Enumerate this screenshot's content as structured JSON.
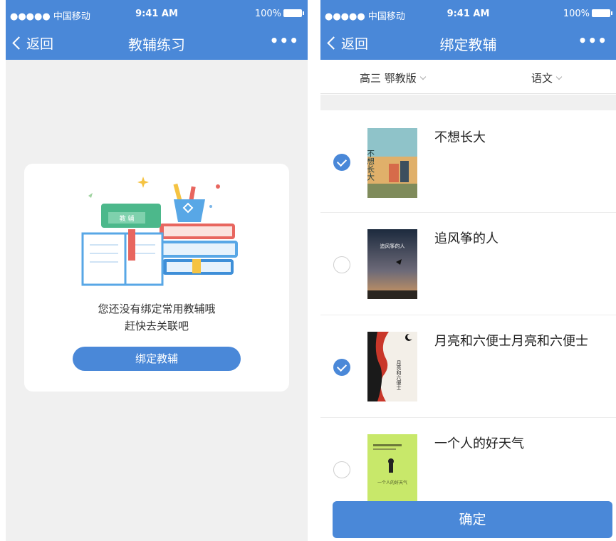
{
  "left_screen": {
    "status": {
      "carrier": "●●●●● 中国移动",
      "time": "9:41 AM",
      "battery": "100%"
    },
    "nav": {
      "back_label": "返回",
      "title": "教辅练习",
      "more": "•••"
    },
    "empty": {
      "illustration_label": "教 辅",
      "line1": "您还没有绑定常用教辅哦",
      "line2": "赶快去关联吧",
      "bind_button": "绑定教辅"
    }
  },
  "right_screen": {
    "status": {
      "carrier": "●●●●● 中国移动",
      "time": "9:41 AM",
      "battery": "100%"
    },
    "nav": {
      "back_label": "返回",
      "title": "绑定教辅",
      "more": "•••"
    },
    "filters": {
      "grade_edition": "高三 鄂教版",
      "subject": "语文"
    },
    "books": [
      {
        "title": "不想长大",
        "checked": true,
        "cover_text": "不想长大"
      },
      {
        "title": "追风筝的人",
        "checked": false,
        "cover_text": "追风筝的人"
      },
      {
        "title": "月亮和六便士月亮和六便士",
        "checked": true,
        "cover_text": "月亮和六便士"
      },
      {
        "title": "一个人的好天气",
        "checked": false,
        "cover_text": "一个人的好天气"
      }
    ],
    "confirm_button": "确定"
  },
  "colors": {
    "accent": "#4a88d8",
    "page_bg": "#f0f0f0"
  }
}
